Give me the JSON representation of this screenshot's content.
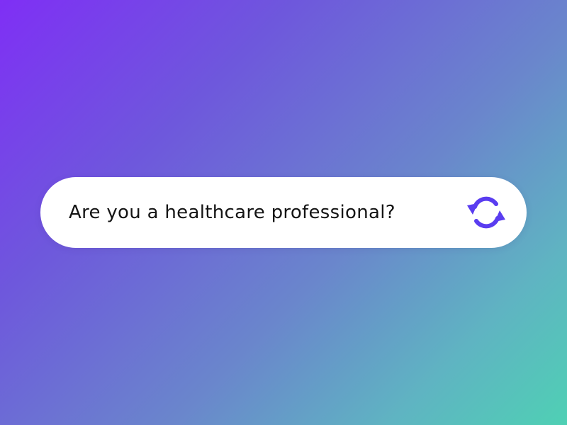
{
  "prompt": {
    "question": "Are you a healthcare professional?"
  },
  "refresh_button": {
    "icon": "refresh-icon",
    "color": "#5a3df0"
  },
  "background": {
    "gradient_start": "#7f2ff5",
    "gradient_end": "#4fd0b4"
  }
}
